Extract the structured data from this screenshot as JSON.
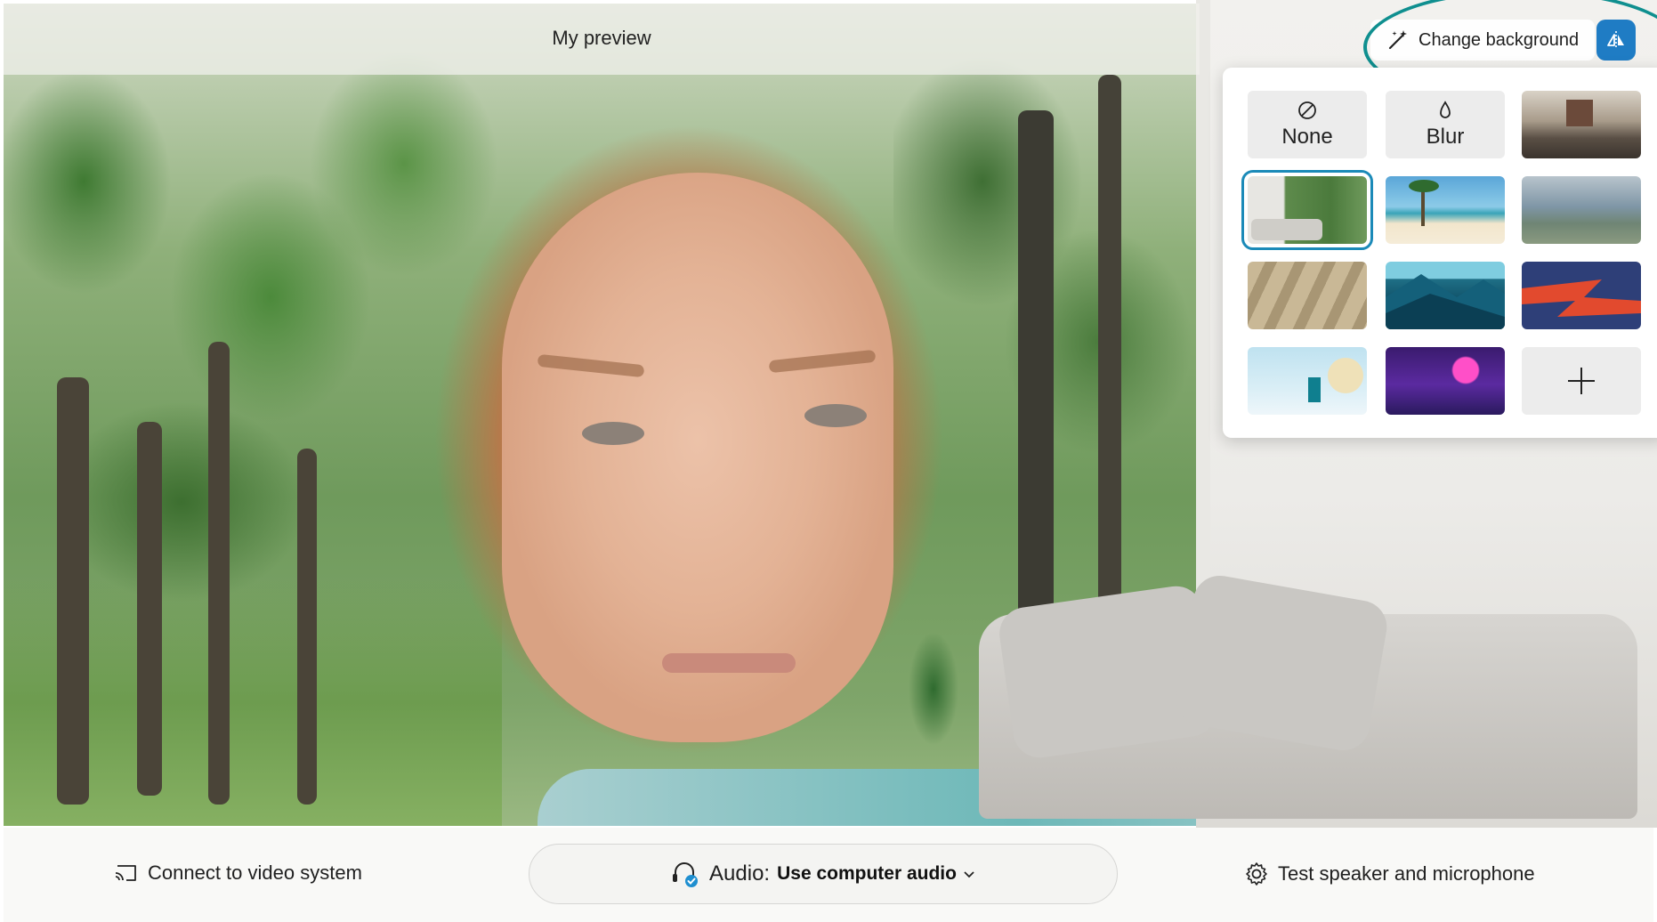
{
  "header": {
    "title": "My preview"
  },
  "toolbar": {
    "change_background_label": "Change background",
    "change_background_icon": "magic-wand-icon",
    "mirror_icon": "mirror-flip-icon"
  },
  "background_panel": {
    "options": [
      {
        "label": "None",
        "icon": "none-icon"
      },
      {
        "label": "Blur",
        "icon": "blur-drop-icon"
      },
      {
        "label": "",
        "kind": "office-room-image"
      },
      {
        "label": "",
        "kind": "forest-living-room-image",
        "selected": true
      },
      {
        "label": "",
        "kind": "beach-palm-image"
      },
      {
        "label": "",
        "kind": "mountain-lake-image"
      },
      {
        "label": "",
        "kind": "shadow-wall-image"
      },
      {
        "label": "",
        "kind": "teal-mountains-image"
      },
      {
        "label": "",
        "kind": "red-blue-abstract-image"
      },
      {
        "label": "",
        "kind": "pastel-room-image"
      },
      {
        "label": "",
        "kind": "purple-neon-image"
      },
      {
        "label": "",
        "kind": "add-icon"
      }
    ]
  },
  "bottom": {
    "connect_label": "Connect to video system",
    "audio_prefix": "Audio:",
    "audio_value": "Use computer audio",
    "test_label": "Test speaker and microphone"
  },
  "colors": {
    "accent": "#1f7cc4",
    "highlight_ring": "#0f8f8f",
    "selected_outline": "#1b8ab8"
  }
}
